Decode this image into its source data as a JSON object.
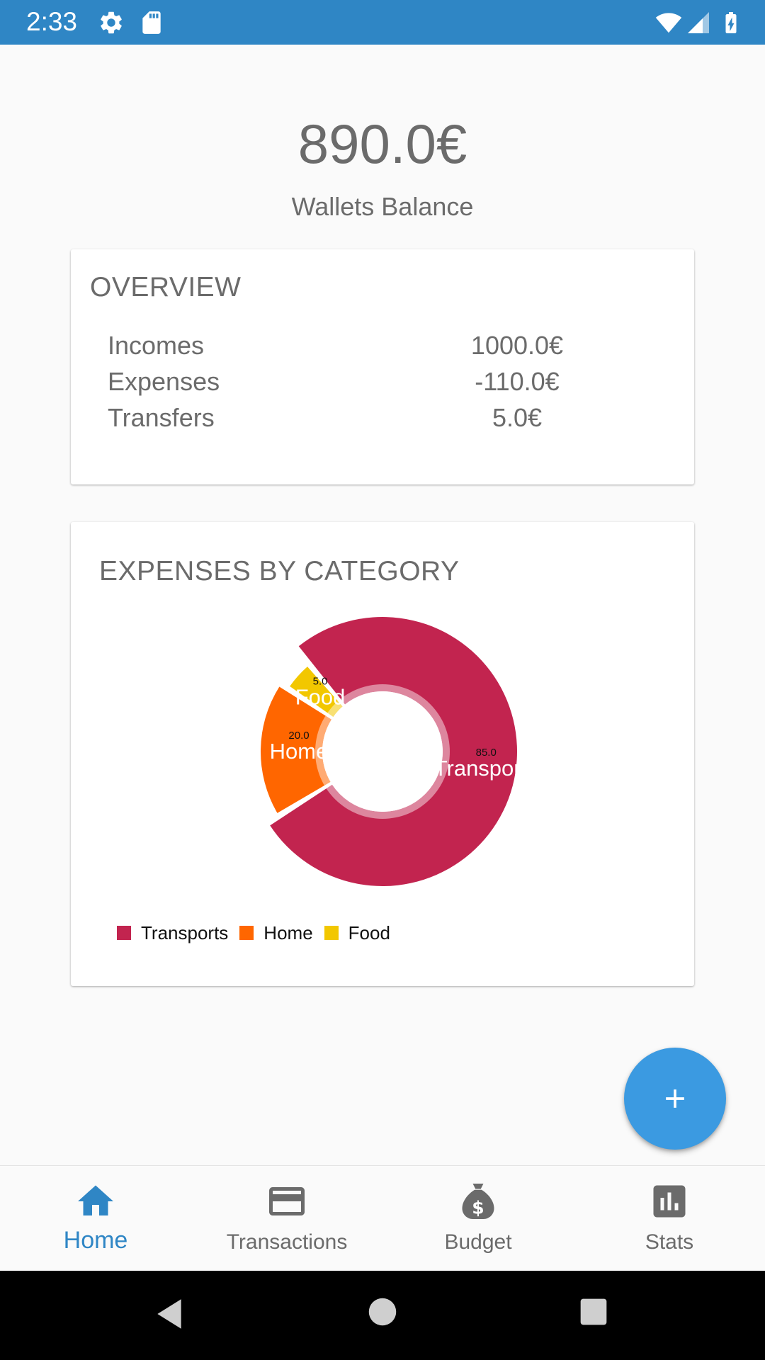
{
  "status_bar": {
    "time": "2:33",
    "background": "#2f86c5",
    "left_icons": [
      "gear-icon",
      "sd-card-icon"
    ],
    "right_icons": [
      "wifi-icon",
      "signal-icon",
      "battery-charging-icon"
    ]
  },
  "balance": {
    "amount": "890.0€",
    "label": "Wallets Balance"
  },
  "overview": {
    "title": "OVERVIEW",
    "rows": [
      {
        "label": "Incomes",
        "value": "1000.0€"
      },
      {
        "label": "Expenses",
        "value": "-110.0€"
      },
      {
        "label": "Transfers",
        "value": "5.0€"
      }
    ]
  },
  "expenses_card": {
    "title": "EXPENSES BY CATEGORY"
  },
  "chart_data": {
    "type": "pie",
    "variant": "donut",
    "categories": [
      "Transports",
      "Home",
      "Food"
    ],
    "values": [
      85.0,
      20.0,
      5.0
    ],
    "value_labels": [
      "85.0",
      "20.0",
      "5.0"
    ],
    "colors": [
      "#c2244f",
      "#ff6600",
      "#f2c700"
    ],
    "legend": [
      "Transports",
      "Home",
      "Food"
    ],
    "legend_position": "bottom-left"
  },
  "fab": {
    "icon": "plus-icon",
    "color": "#3b9ae1"
  },
  "bottom_nav": {
    "active_color": "#2f86c5",
    "inactive_color": "#6b6b6b",
    "items": [
      {
        "label": "Home",
        "icon": "home-icon",
        "active": true
      },
      {
        "label": "Transactions",
        "icon": "credit-card-icon",
        "active": false
      },
      {
        "label": "Budget",
        "icon": "money-bag-icon",
        "active": false
      },
      {
        "label": "Stats",
        "icon": "bar-chart-icon",
        "active": false
      }
    ]
  },
  "system_nav": {
    "icons": [
      "back-icon",
      "home-circle-icon",
      "recents-icon"
    ]
  }
}
